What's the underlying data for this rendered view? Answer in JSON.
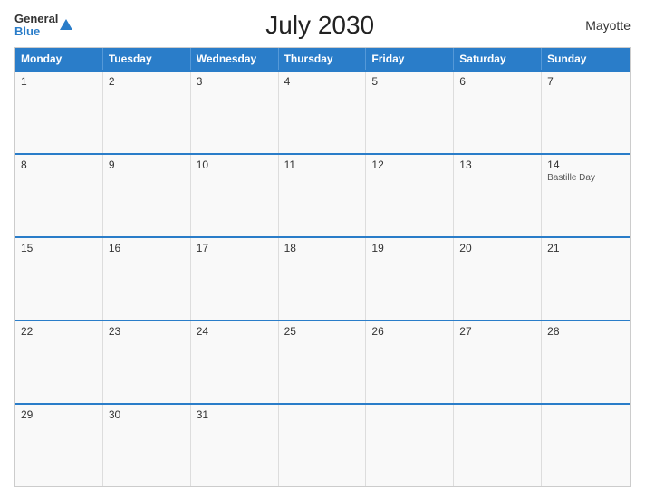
{
  "header": {
    "logo_general": "General",
    "logo_blue": "Blue",
    "title": "July 2030",
    "region": "Mayotte"
  },
  "weekdays": [
    "Monday",
    "Tuesday",
    "Wednesday",
    "Thursday",
    "Friday",
    "Saturday",
    "Sunday"
  ],
  "weeks": [
    [
      {
        "day": "1"
      },
      {
        "day": "2"
      },
      {
        "day": "3"
      },
      {
        "day": "4"
      },
      {
        "day": "5"
      },
      {
        "day": "6"
      },
      {
        "day": "7"
      }
    ],
    [
      {
        "day": "8"
      },
      {
        "day": "9"
      },
      {
        "day": "10"
      },
      {
        "day": "11"
      },
      {
        "day": "12"
      },
      {
        "day": "13"
      },
      {
        "day": "14",
        "holiday": "Bastille Day"
      }
    ],
    [
      {
        "day": "15"
      },
      {
        "day": "16"
      },
      {
        "day": "17"
      },
      {
        "day": "18"
      },
      {
        "day": "19"
      },
      {
        "day": "20"
      },
      {
        "day": "21"
      }
    ],
    [
      {
        "day": "22"
      },
      {
        "day": "23"
      },
      {
        "day": "24"
      },
      {
        "day": "25"
      },
      {
        "day": "26"
      },
      {
        "day": "27"
      },
      {
        "day": "28"
      }
    ],
    [
      {
        "day": "29"
      },
      {
        "day": "30"
      },
      {
        "day": "31"
      },
      {
        "day": ""
      },
      {
        "day": ""
      },
      {
        "day": ""
      },
      {
        "day": ""
      }
    ]
  ]
}
